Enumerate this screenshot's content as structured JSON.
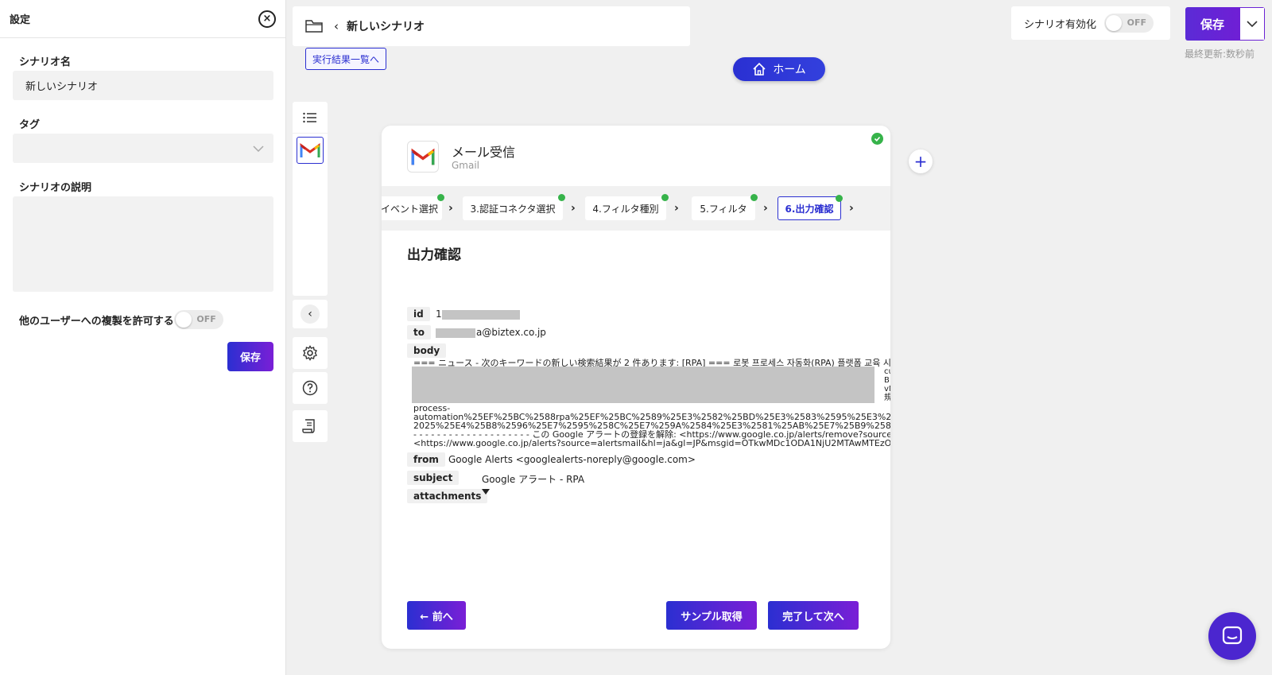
{
  "settings": {
    "title": "設定",
    "name_label": "シナリオ名",
    "name_value": "新しいシナリオ",
    "tag_label": "タグ",
    "description_label": "シナリオの説明",
    "copy_allow_label": "他のユーザーへの複製を許可する",
    "copy_allow_toggle": "OFF",
    "save_label": "保存"
  },
  "header": {
    "scenario_title": "新しいシナリオ",
    "results_link": "実行結果一覧へ",
    "home_label": "ホーム",
    "enable_label": "シナリオ有効化",
    "enable_toggle": "OFF",
    "save_label": "保存",
    "last_updated": "最終更新:数秒前"
  },
  "card": {
    "title": "メール受信",
    "subtitle": "Gmail",
    "steps": [
      {
        "label": "イベント選択",
        "done": true
      },
      {
        "label": "3.認証コネクタ選択",
        "done": true
      },
      {
        "label": "4.フィルタ種別",
        "done": true
      },
      {
        "label": "5.フィルタ",
        "done": true
      },
      {
        "label": "6.出力確認",
        "done": true,
        "active": true
      }
    ],
    "section_title": "出力確認",
    "fields": {
      "id_key": "id",
      "id_value": "1",
      "to_key": "to",
      "to_value": "a@biztex.co.jp",
      "body_key": "body",
      "body_lines": [
        "=== ニュース - 次のキーワードの新しい検索結果が 2 件あります: [RPA] === 로봇 프로세스 자동화(RPA) 플랫폼 교육 시",
        "process-",
        "automation%25EF%25BC%2588rpa%25EF%25BC%2589%25E3%2582%25BD%25E3%2583%2595%25E3%2",
        "2025%25E4%25B8%2596%25E7%2595%258C%25E7%259A%2584%25E3%2581%25AB%25E7%25B9%2581",
        "- - - - - - - - - - - - - - - - - - - - この Google アラートの登録を解除: <https://www.google.co.jp/alerts/remove?source=",
        "<https://www.google.co.jp/alerts?source=alertsmail&hl=ja&gl=JP&msgid=OTkwMDc1ODA1NjU2MTAwMTEzO"
      ],
      "body_side_chars": [
        "cu",
        "B",
        "vN",
        "規"
      ],
      "from_key": "from",
      "from_value": "Google Alerts <googlealerts-noreply@google.com>",
      "subject_key": "subject",
      "subject_value": "Google アラート - RPA",
      "attachments_key": "attachments"
    },
    "prev_label": "← 前へ",
    "sample_label": "サンプル取得",
    "next_label": "完了して次へ"
  },
  "colors": {
    "accent": "#2b2fd1",
    "accent_purple": "#7a1fd6",
    "success": "#36b34a"
  }
}
